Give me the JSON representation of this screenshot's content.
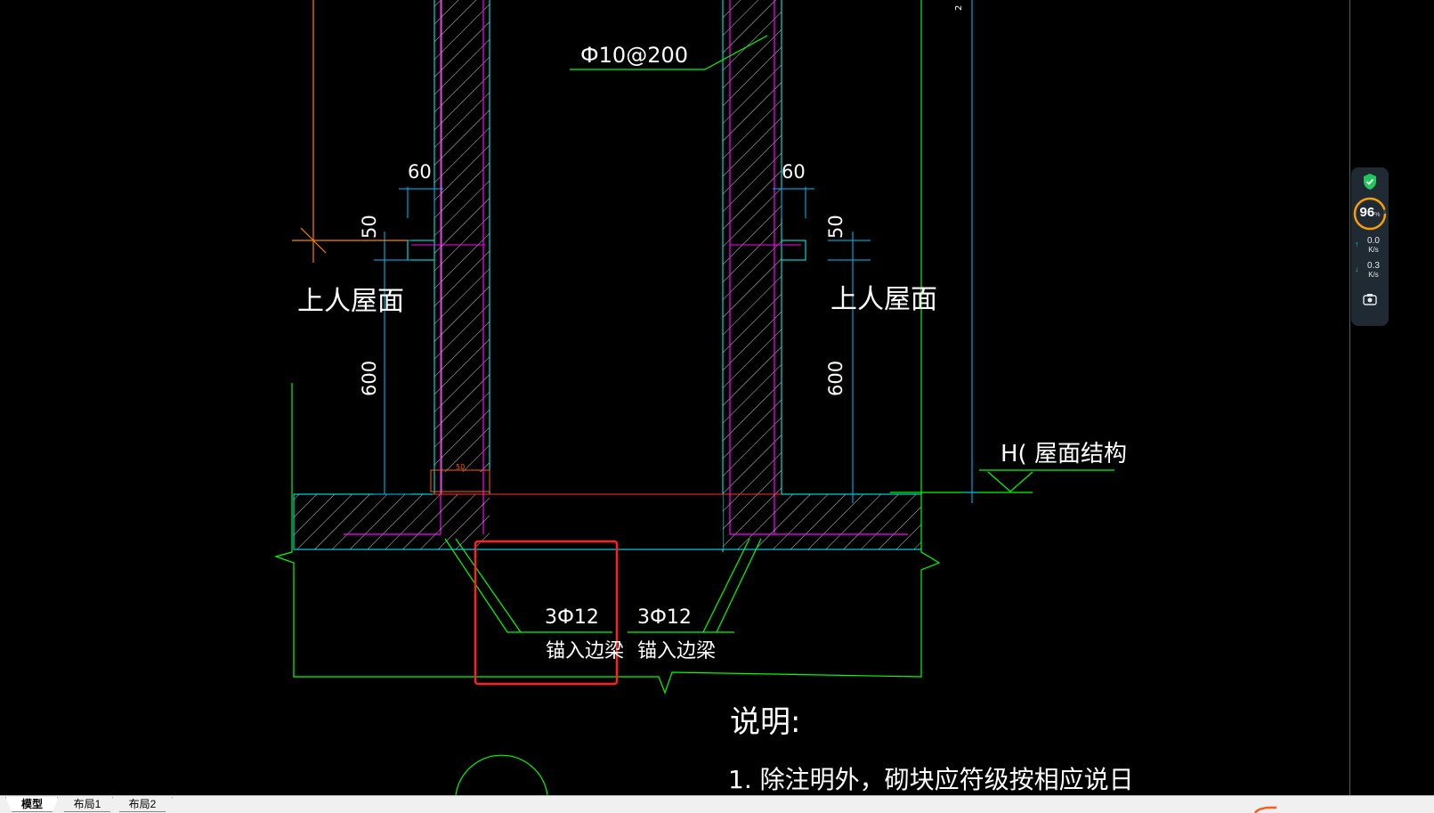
{
  "drawing": {
    "labels": {
      "rebar_top": "Ф10@200",
      "dim_60_left": "60",
      "dim_60_right": "60",
      "dim_50_left": "50",
      "dim_50_right": "50",
      "dim_600_left": "600",
      "dim_600_right": "600",
      "roof_left": "上人屋面",
      "roof_right": "上人屋面",
      "roof_structure": "H( 屋面结构",
      "bar_left": "3Ф12",
      "bar_right": "3Ф12",
      "anchor_left": "锚入边梁",
      "anchor_right": "锚入边梁",
      "notes_title": "说明:",
      "notes_line1": "1. 除注明外，砌块应符级按相应说日",
      "small_50": "50",
      "top_dim": "2"
    },
    "colors": {
      "background": "#000000",
      "concrete_outline": "#00ffff",
      "rebar": "#ff00ff",
      "leader": "#00ff00",
      "dimension": "#00bfff",
      "highlight": "#ff2020",
      "axis": "#ff8000"
    }
  },
  "tabs": [
    {
      "label": "模型",
      "active": true
    },
    {
      "label": "布局1",
      "active": false
    },
    {
      "label": "布局2",
      "active": false
    }
  ],
  "widget": {
    "shield_icon": "shield-check-icon",
    "percent": "96",
    "percent_unit": "%",
    "upload_value": "0.0",
    "upload_unit": "K/s",
    "download_value": "0.3",
    "download_unit": "K/s",
    "camera_icon": "camera-icon"
  }
}
